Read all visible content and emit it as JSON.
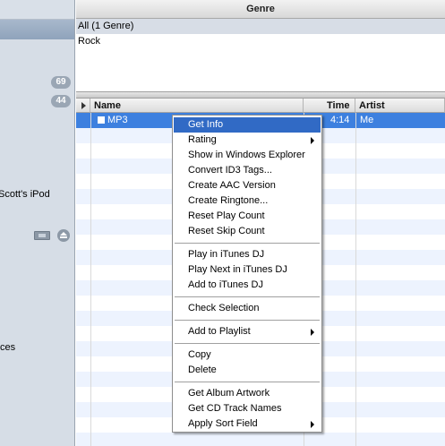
{
  "sidebar": {
    "badge_1": "69",
    "badge_2": "44",
    "ipod_label": "Scott's iPod",
    "item_partial": "ces"
  },
  "genre_browser": {
    "header": "Genre",
    "items": [
      "All (1 Genre)",
      "Rock"
    ]
  },
  "track_list": {
    "columns": {
      "name": "Name",
      "time": "Time",
      "artist": "Artist"
    },
    "rows": [
      {
        "name": "MP3",
        "time": "4:14",
        "artist": "Me",
        "selected": true
      }
    ]
  },
  "context_menu": {
    "items": [
      {
        "label": "Get Info",
        "highlighted": true
      },
      {
        "label": "Rating",
        "submenu": true
      },
      {
        "label": "Show in Windows Explorer"
      },
      {
        "label": "Convert ID3 Tags..."
      },
      {
        "label": "Create AAC Version"
      },
      {
        "label": "Create Ringtone..."
      },
      {
        "label": "Reset Play Count"
      },
      {
        "label": "Reset Skip Count"
      },
      {
        "separator": true
      },
      {
        "label": "Play in iTunes DJ"
      },
      {
        "label": "Play Next in iTunes DJ"
      },
      {
        "label": "Add to iTunes DJ"
      },
      {
        "separator": true
      },
      {
        "label": "Check Selection"
      },
      {
        "separator": true
      },
      {
        "label": "Add to Playlist",
        "submenu": true
      },
      {
        "separator": true
      },
      {
        "label": "Copy"
      },
      {
        "label": "Delete"
      },
      {
        "separator": true
      },
      {
        "label": "Get Album Artwork"
      },
      {
        "label": "Get CD Track Names"
      },
      {
        "label": "Apply Sort Field",
        "submenu": true
      }
    ]
  },
  "colors": {
    "selection_blue": "#3d80df",
    "menu_highlight": "#316ac5",
    "sidebar_bg": "#d6dde6"
  }
}
